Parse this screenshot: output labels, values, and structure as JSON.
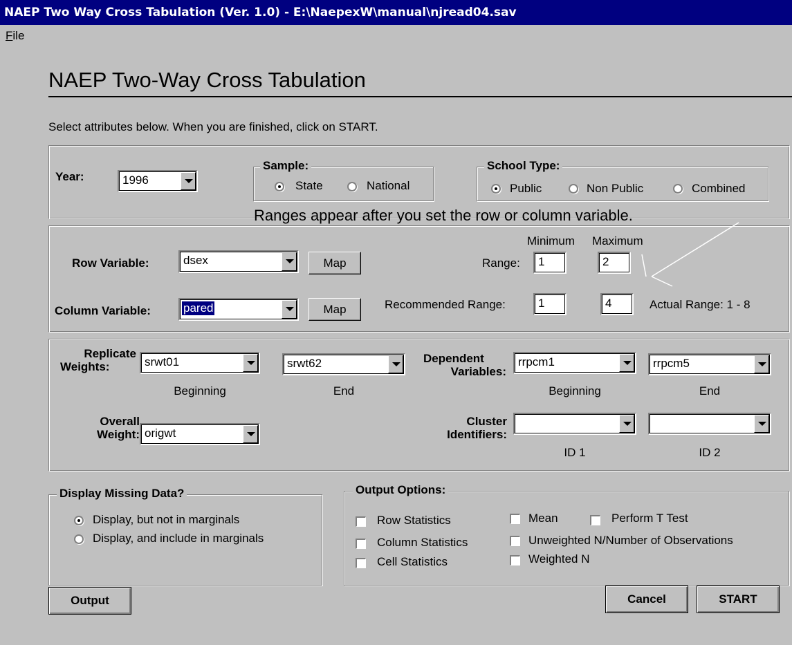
{
  "window": {
    "title": "NAEP Two Way Cross Tabulation (Ver. 1.0) - E:\\NaepexW\\manual\\njread04.sav"
  },
  "menu": {
    "file_ul": "F",
    "file_rest": "ile"
  },
  "heading": "NAEP Two-Way Cross Tabulation",
  "instructions": "Select attributes below.  When you are finished, click on START.",
  "year": {
    "label": "Year:",
    "value": "1996"
  },
  "sample": {
    "legend": "Sample:",
    "options": [
      "State",
      "National"
    ],
    "selected": "State"
  },
  "school_type": {
    "legend": "School Type:",
    "options": [
      "Public",
      "Non Public",
      "Combined"
    ],
    "selected": "Public"
  },
  "ranges_note": "Ranges appear after you set the row or column variable.",
  "variables": {
    "row_label": "Row Variable:",
    "row_value": "dsex",
    "column_label": "Column Variable:",
    "column_value": "pared",
    "map_label": "Map"
  },
  "range": {
    "minimum_header": "Minimum",
    "maximum_header": "Maximum",
    "range_label": "Range:",
    "range_min": "1",
    "range_max": "2",
    "recommended_label": "Recommended Range:",
    "recommended_min": "1",
    "recommended_max": "4",
    "actual_range": "Actual Range: 1 - 8"
  },
  "weights": {
    "replicate_label_1": "Replicate",
    "replicate_label_2": "Weights:",
    "replicate_begin": "srwt01",
    "replicate_end": "srwt62",
    "dependent_label_1": "Dependent",
    "dependent_label_2": "Variables:",
    "dependent_begin": "rrpcm1",
    "dependent_end": "rrpcm5",
    "beginning": "Beginning",
    "end": "End",
    "overall_label_1": "Overall",
    "overall_label_2": "Weight:",
    "overall_value": "origwt",
    "cluster_label_1": "Cluster",
    "cluster_label_2": "Identifiers:",
    "cluster_id1": "",
    "cluster_id2": "",
    "id1": "ID 1",
    "id2": "ID 2"
  },
  "missing_data": {
    "legend": "Display Missing Data?",
    "options": [
      "Display, but not in marginals",
      "Display, and include in marginals"
    ],
    "selected": "Display, but not in marginals"
  },
  "output_options": {
    "legend": "Output Options:",
    "items": [
      "Row Statistics",
      "Column Statistics",
      "Cell Statistics",
      "Mean",
      "Unweighted N/Number of Observations",
      "Weighted N",
      "Perform T Test"
    ],
    "checked": []
  },
  "buttons": {
    "output": "Output",
    "cancel": "Cancel",
    "start": "START"
  }
}
